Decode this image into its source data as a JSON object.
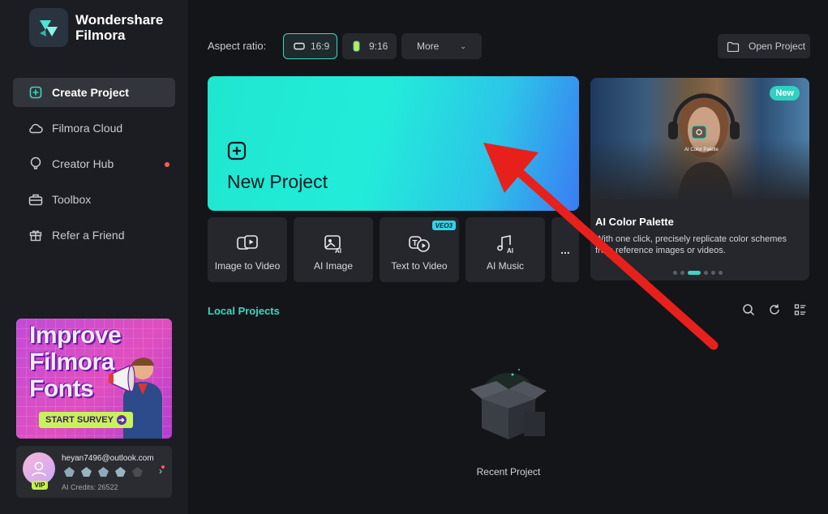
{
  "app": {
    "name_line1": "Wondershare",
    "name_line2": "Filmora"
  },
  "sidebar": {
    "items": [
      {
        "label": "Create Project",
        "icon": "plus-square-icon",
        "active": true
      },
      {
        "label": "Filmora Cloud",
        "icon": "cloud-icon"
      },
      {
        "label": "Creator Hub",
        "icon": "lightbulb-icon",
        "notification": true
      },
      {
        "label": "Toolbox",
        "icon": "toolbox-icon"
      },
      {
        "label": "Refer a Friend",
        "icon": "gift-icon"
      }
    ]
  },
  "promo": {
    "title": "Improve Filmora Fonts",
    "cta": "START SURVEY"
  },
  "account": {
    "email": "heyan7496@outlook.com",
    "badge": "VIP",
    "credits": "AI Credits: 26522"
  },
  "aspect": {
    "label": "Aspect ratio:",
    "options": [
      "16:9",
      "9:16"
    ],
    "selected": "16:9",
    "more": "More"
  },
  "open_project": "Open Project",
  "new_project": "New Project",
  "tools": [
    {
      "label": "Image to Video",
      "icon": "image-to-video-icon"
    },
    {
      "label": "AI Image",
      "icon": "ai-image-icon"
    },
    {
      "label": "Text to Video",
      "icon": "text-to-video-icon",
      "badge": "VEO3"
    },
    {
      "label": "AI Music",
      "icon": "ai-music-icon"
    }
  ],
  "more_tools": "...",
  "feature": {
    "badge": "New",
    "title": "AI Color Palette",
    "description": "With one click, precisely replicate color schemes from reference images or videos.",
    "overlay_label": "AI Color Palette"
  },
  "local_projects": {
    "title": "Local Projects",
    "empty_label": "Recent Project"
  },
  "colors": {
    "accent": "#3dd6c0",
    "annotation_arrow": "#e8201c"
  }
}
